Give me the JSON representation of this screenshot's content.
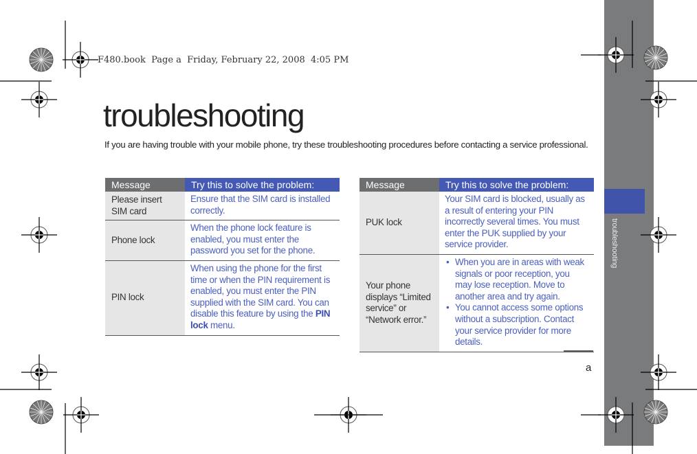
{
  "book_header": "F480.book  Page a  Friday, February 22, 2008  4:05 PM",
  "page_title": "troubleshooting",
  "intro": "If you are having trouble with your mobile phone, try these troubleshooting procedures before contacting a service professional.",
  "sidebar": {
    "section_label": "troubleshooting",
    "tab_color": "#3f53a8",
    "bar_color": "#7a7b7d"
  },
  "tables": {
    "left": {
      "headers": {
        "message": "Message",
        "solution": "Try this to solve the problem:"
      },
      "rows": [
        {
          "message": "Please insert SIM card",
          "solution": "Ensure that the SIM card is installed correctly."
        },
        {
          "message": "Phone lock",
          "solution": "When the phone lock feature is enabled, you must enter the password you set for the phone."
        },
        {
          "message": "PIN lock",
          "solution_pre": "When using the phone for the first time or when the PIN requirement is enabled, you must enter the PIN supplied with the SIM card. You can disable this feature by using the ",
          "solution_bold": "PIN lock",
          "solution_post": " menu."
        }
      ]
    },
    "right": {
      "headers": {
        "message": "Message",
        "solution": "Try this to solve the problem:"
      },
      "rows": [
        {
          "message": "PUK lock",
          "solution": "Your SIM card is blocked, usually as a result of entering your PIN incorrectly several times. You must enter the PUK supplied by your service provider."
        },
        {
          "message": "Your phone displays “Limited service” or “Network error.”",
          "bullets": [
            "When you are in areas with weak signals or poor reception, you may lose reception. Move to another area and try again.",
            "You cannot access some options without a subscription. Contact your service provider for more details."
          ]
        }
      ]
    }
  },
  "colors": {
    "header_message_bg": "#6d6e70",
    "header_solution_bg": "#4359b4",
    "solution_text": "#4a5fbf",
    "message_cell_bg": "#e6e6e6"
  },
  "page_number": "a"
}
